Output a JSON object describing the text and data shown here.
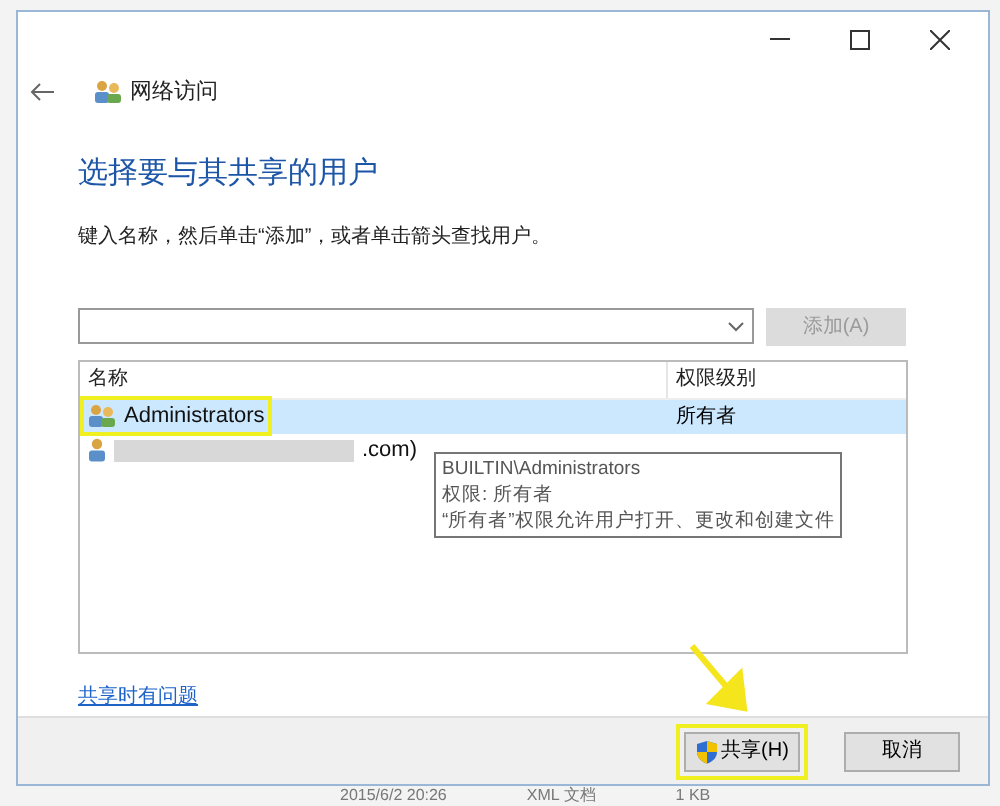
{
  "window": {
    "title": "网络访问"
  },
  "heading": "选择要与其共享的用户",
  "instruction": "键入名称，然后单击“添加”，或者单击箭头查找用户。",
  "name_field": {
    "add_button": {
      "label": "添加(A)",
      "disabled": true
    }
  },
  "table": {
    "columns": [
      "名称",
      "权限级别"
    ],
    "rows": [
      {
        "kind": "group",
        "name": "Administrators",
        "permission": "所有者",
        "selected": true,
        "highlighted": true
      },
      {
        "kind": "user",
        "name": ".com)",
        "permission": "",
        "selected": false,
        "highlighted": false,
        "blurred": true
      }
    ]
  },
  "tooltip": {
    "lines": [
      "BUILTIN\\Administrators",
      "权限: 所有者",
      "“所有者”权限允许用户打开、更改和创建文件"
    ]
  },
  "help_link": "共享时有问题",
  "buttons": [
    {
      "label": "共享(H)",
      "shield": true,
      "highlighted": true
    },
    {
      "label": "取消",
      "shield": false,
      "highlighted": false
    }
  ],
  "background_row": [
    "2015/6/2 20:26",
    "XML 文档",
    "1 KB"
  ]
}
